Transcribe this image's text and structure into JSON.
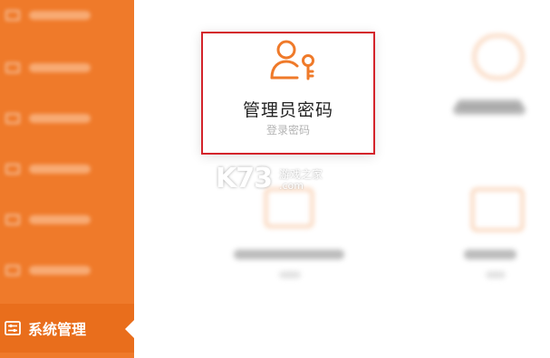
{
  "sidebar": {
    "active_label": "系统管理",
    "accent_color": "#ef7a2a"
  },
  "card": {
    "title": "管理员密码",
    "subtitle": "登录密码",
    "icon": "user-key-icon",
    "border_color": "#d4242b"
  },
  "watermark": {
    "logo": "K73",
    "tagline": "游戏之家",
    "domain": ".com"
  }
}
